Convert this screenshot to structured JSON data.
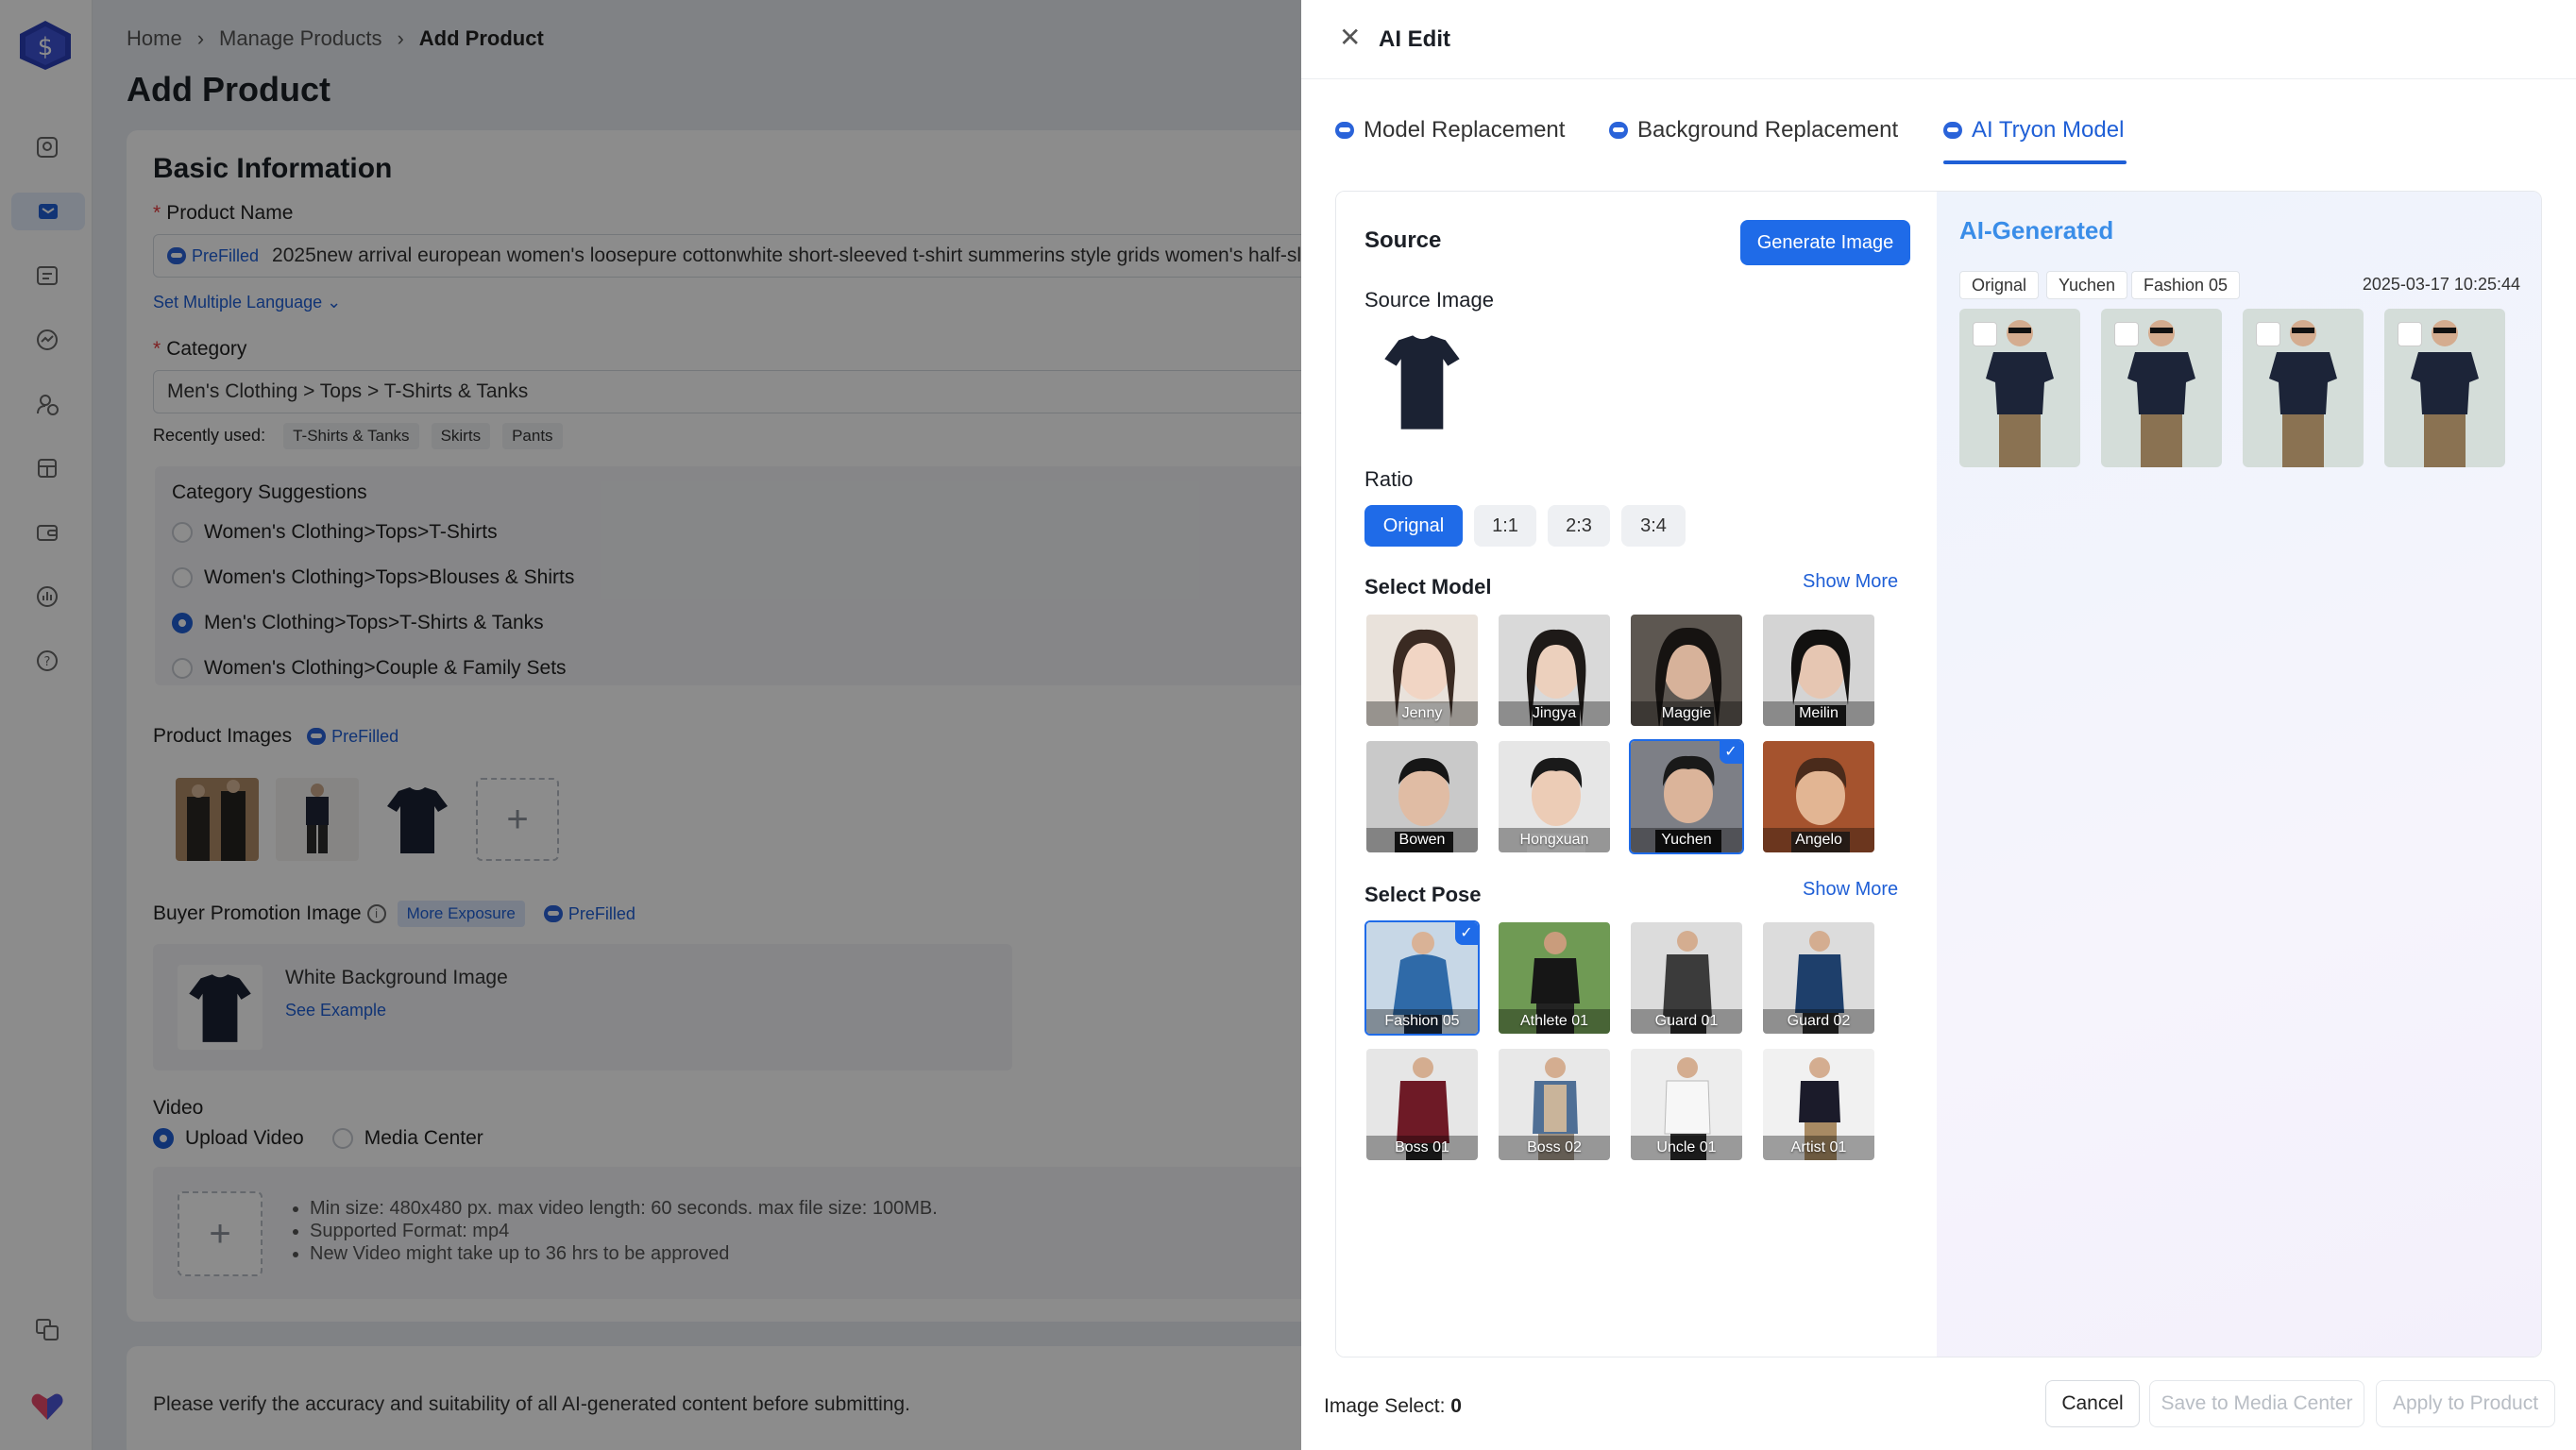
{
  "breadcrumb": {
    "home": "Home",
    "manage": "Manage Products",
    "current": "Add Product"
  },
  "page_title": "Add Product",
  "basic": {
    "heading": "Basic Information",
    "product_name_label": "Product Name",
    "prefilled": "PreFilled",
    "product_name_value": "2025new arrival european women's loosepure cottonwhite short-sleeved t-shirt summerins style grids women's half-sle",
    "set_language": "Set Multiple Language",
    "category_label": "Category",
    "category_value": "Men's Clothing > Tops > T-Shirts & Tanks",
    "recently_used_label": "Recently used:",
    "recent_tags": [
      "T-Shirts & Tanks",
      "Skirts",
      "Pants"
    ],
    "suggestions_title": "Category Suggestions",
    "suggestions": [
      {
        "label": "Women's Clothing>Tops>T-Shirts",
        "selected": false
      },
      {
        "label": "Women's Clothing>Tops>Blouses & Shirts",
        "selected": false
      },
      {
        "label": "Men's Clothing>Tops>T-Shirts & Tanks",
        "selected": true
      },
      {
        "label": "Women's Clothing>Couple & Family Sets",
        "selected": false
      }
    ],
    "product_images_label": "Product Images",
    "buyer_promo_label": "Buyer Promotion Image",
    "more_exposure": "More Exposure",
    "white_bg": "White Background Image",
    "see_example": "See Example",
    "video_label": "Video",
    "upload_video": "Upload Video",
    "media_center": "Media Center",
    "video_notes": [
      "Min size: 480x480 px. max video length: 60 seconds. max file size: 100MB.",
      "Supported Format: mp4",
      "New Video might take up to 36 hrs to be approved"
    ]
  },
  "verify_text": "Please verify the accuracy and suitability of all AI-generated content before submitting.",
  "drawer": {
    "title": "AI Edit",
    "tabs": [
      "Model Replacement",
      "Background Replacement",
      "AI Tryon Model"
    ],
    "active_tab": "AI Tryon Model",
    "source_heading": "Source",
    "generate_btn": "Generate Image",
    "source_image_label": "Source Image",
    "ratio_label": "Ratio",
    "ratios": [
      "Orignal",
      "1:1",
      "2:3",
      "3:4"
    ],
    "select_model_label": "Select Model",
    "show_more": "Show More",
    "models": [
      "Jenny",
      "Jingya",
      "Maggie",
      "Meilin",
      "Bowen",
      "Hongxuan",
      "Yuchen",
      "Angelo"
    ],
    "selected_model": "Yuchen",
    "select_pose_label": "Select Pose",
    "poses": [
      "Fashion 05",
      "Athlete 01",
      "Guard 01",
      "Guard 02",
      "Boss 01",
      "Boss 02",
      "Uncle 01",
      "Artist 01"
    ],
    "selected_pose": "Fashion 05",
    "ai_generated_title": "AI-Generated",
    "gen_chips": [
      "Orignal",
      "Yuchen",
      "Fashion 05"
    ],
    "gen_timestamp": "2025-03-17 10:25:44",
    "image_select_label": "Image Select:",
    "image_select_count": "0",
    "cancel": "Cancel",
    "save_media": "Save to Media Center",
    "apply": "Apply to Product"
  },
  "colors": {
    "accent": "#1f6be8",
    "link": "#1f5fd6",
    "required": "#e4393c"
  }
}
